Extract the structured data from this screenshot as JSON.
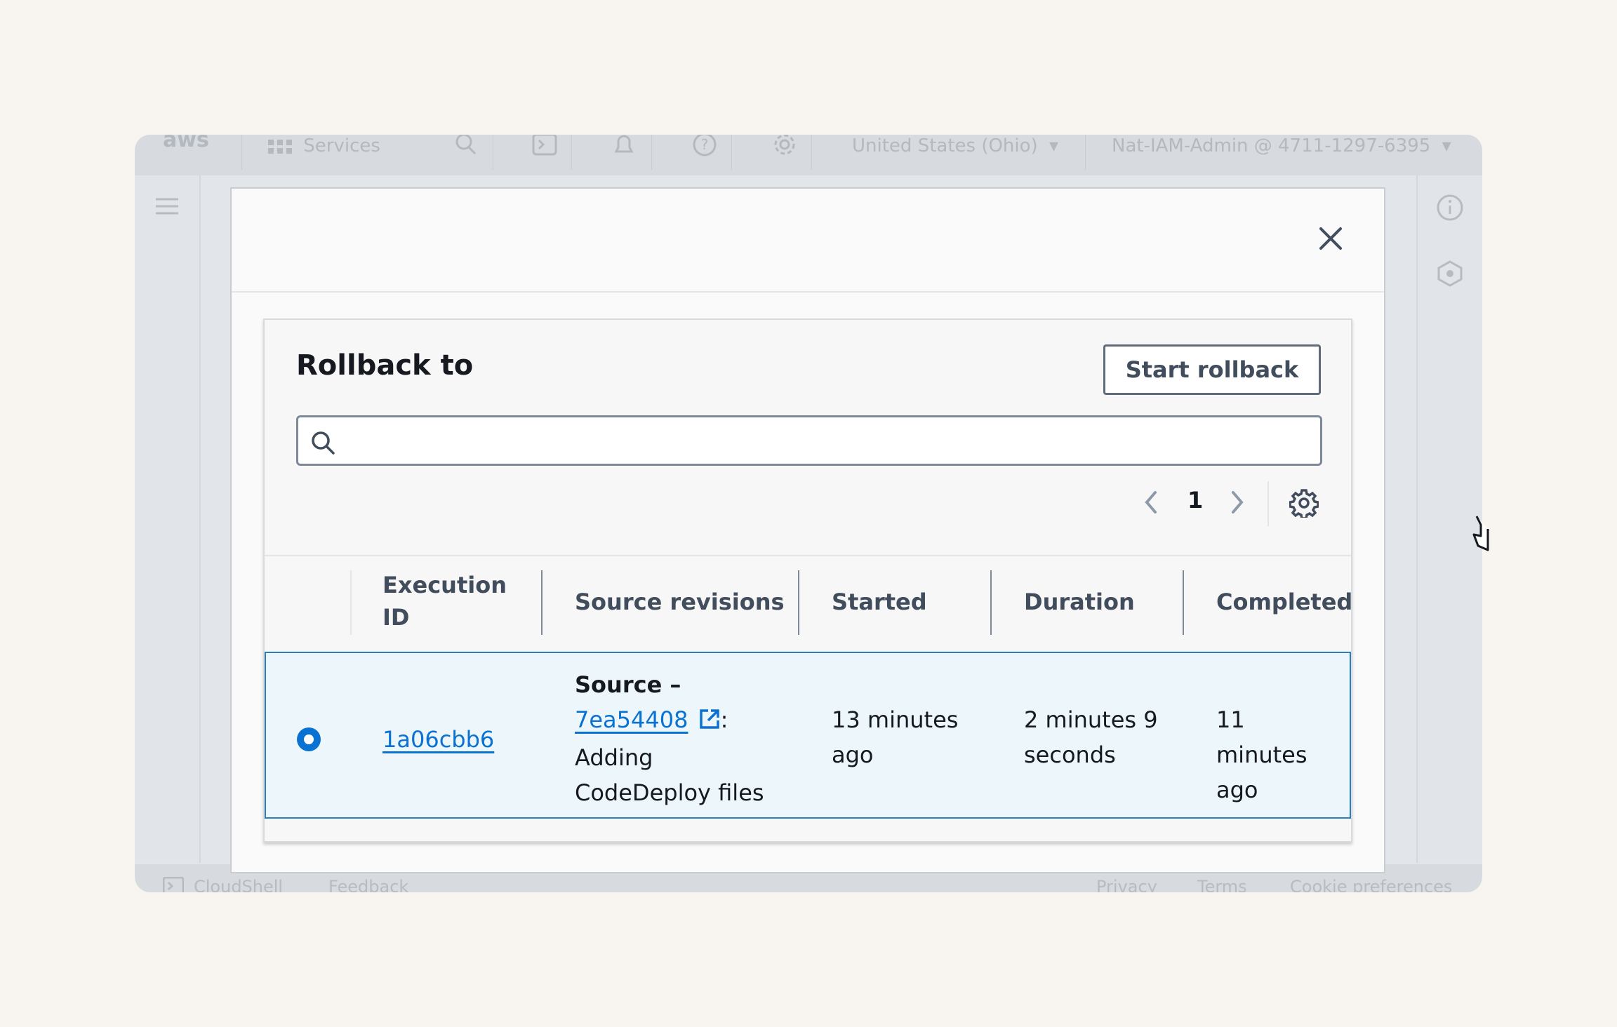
{
  "console": {
    "services_label": "Services",
    "region_label": "United States (Ohio)",
    "account_label": "Nat-IAM-Admin @ 4711-1297-6395",
    "footer": {
      "cloudshell": "CloudShell",
      "feedback": "Feedback",
      "privacy": "Privacy",
      "terms": "Terms",
      "cookies": "Cookie preferences"
    }
  },
  "modal": {
    "title": "Rollback to",
    "start_button": "Start rollback",
    "search_placeholder": "",
    "pagination": {
      "current_page": "1"
    },
    "table": {
      "columns": [
        "Execution ID",
        "Source revisions",
        "Started",
        "Duration",
        "Completed"
      ],
      "rows": [
        {
          "selected": true,
          "execution_id": "1a06cbb6",
          "source_label": "Source –",
          "source_commit": "7ea54408",
          "source_suffix": ":",
          "source_message": "Adding CodeDeploy files",
          "started": "13 minutes ago",
          "duration": "2 minutes 9 seconds",
          "completed": "11 minutes ago"
        }
      ]
    }
  },
  "colors": {
    "accent": "#0972d3",
    "selected_row_bg": "#edf7fb",
    "selected_row_border": "#2b7fbd"
  }
}
